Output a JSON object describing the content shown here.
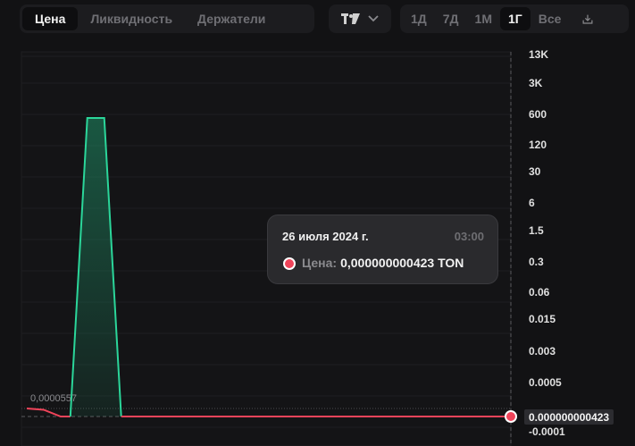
{
  "tabs": [
    {
      "label": "Цена",
      "active": true
    },
    {
      "label": "Ликвидность",
      "active": false
    },
    {
      "label": "Держатели",
      "active": false
    }
  ],
  "chart_style": {
    "icon": "tradingview-logo-icon",
    "dropdown_icon": "chevron-down-icon"
  },
  "ranges": [
    {
      "label": "1Д",
      "active": false
    },
    {
      "label": "7Д",
      "active": false
    },
    {
      "label": "1М",
      "active": false
    },
    {
      "label": "1Г",
      "active": true
    },
    {
      "label": "Все",
      "active": false
    }
  ],
  "download_icon": "download-icon",
  "colors": {
    "up": "#2bd69a",
    "down": "#f0445a",
    "background": "#121214",
    "tooltip_bg": "#2a2a2d"
  },
  "tooltip": {
    "date": "26 июля 2024 г.",
    "time": "03:00",
    "label": "Цена:",
    "value": "0,000000000423 TON"
  },
  "left_label": "0,0000557",
  "current_price_label": "0.000000000423",
  "chart_data": {
    "type": "line",
    "scale": "log",
    "y_ticks": [
      "13K",
      "3K",
      "600",
      "120",
      "30",
      "6",
      "1.5",
      "0.3",
      "0.06",
      "0.015",
      "0.003",
      "0.0005",
      "-0.0001"
    ],
    "series": [
      {
        "points": [
          {
            "x": 0,
            "y": 4e-05
          },
          {
            "x": 0.035,
            "y": 3e-05
          },
          {
            "x": 0.07,
            "y": 4.2e-10
          },
          {
            "x": 0.09,
            "y": 4.2e-10
          },
          {
            "x": 0.125,
            "y": 2500
          },
          {
            "x": 0.16,
            "y": 2500
          },
          {
            "x": 0.195,
            "y": 4.23e-10
          },
          {
            "x": 1,
            "y": 4.23e-10
          }
        ]
      }
    ]
  }
}
